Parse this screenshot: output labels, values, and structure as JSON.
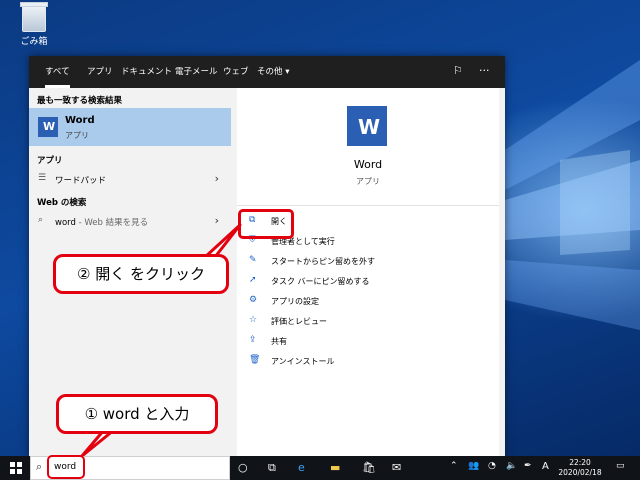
{
  "desktop": {
    "recycle_bin_label": "ごみ箱"
  },
  "search_panel": {
    "tabs": [
      "すべて",
      "アプリ",
      "ドキュメント",
      "電子メール",
      "ウェブ",
      "その他 ▾"
    ],
    "left": {
      "best_match_heading": "最も一致する検索結果",
      "best_match": {
        "name": "Word",
        "type": "アプリ"
      },
      "apps_heading": "アプリ",
      "apps": [
        {
          "label": "ワードパッド"
        }
      ],
      "web_heading": "Web の検索",
      "web": [
        {
          "label": "word",
          "sub": " - Web 結果を見る"
        }
      ]
    },
    "right": {
      "app_name": "Word",
      "app_type": "アプリ",
      "actions": [
        {
          "icon": "open-icon",
          "label": "開く"
        },
        {
          "icon": "admin-icon",
          "label": "管理者として実行"
        },
        {
          "icon": "unpin-start-icon",
          "label": "スタートからピン留めを外す"
        },
        {
          "icon": "pin-taskbar-icon",
          "label": "タスク バーにピン留めする"
        },
        {
          "icon": "gear-icon",
          "label": "アプリの設定"
        },
        {
          "icon": "rate-icon",
          "label": "評価とレビュー"
        },
        {
          "icon": "share-icon",
          "label": "共有"
        },
        {
          "icon": "trash-icon",
          "label": "アンインストール"
        }
      ]
    }
  },
  "callouts": {
    "step2": "② 開く をクリック",
    "step1": "① word と入力"
  },
  "taskbar": {
    "search_value": "word",
    "clock_time": "22:20",
    "clock_date": "2020/02/18",
    "ime_indicator": "A"
  },
  "colors": {
    "accent": "#1c64c8",
    "highlight_red": "#e3000f",
    "best_match_bg": "#aacbeb",
    "word_blue": "#2b5fb3"
  }
}
